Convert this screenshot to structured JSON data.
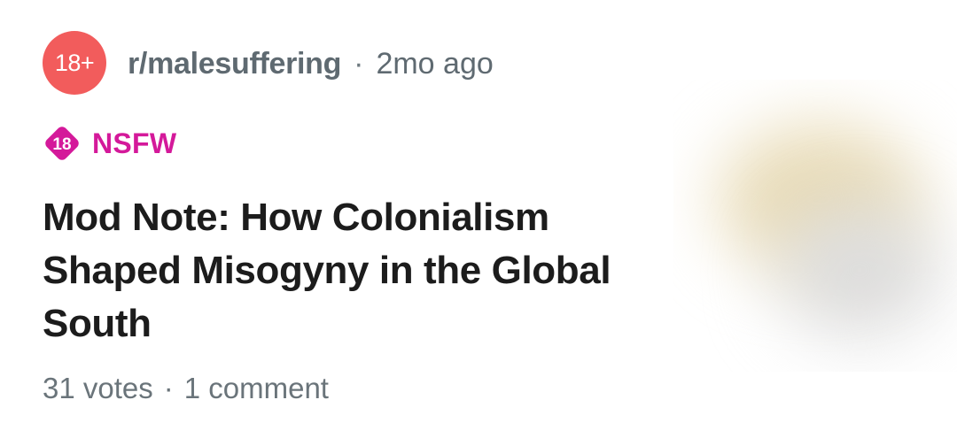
{
  "post": {
    "subreddit": {
      "avatar_text": "18+",
      "name": "r/malesuffering",
      "separator": "·",
      "age": "2mo ago"
    },
    "nsfw": {
      "icon_text": "18",
      "label": "NSFW"
    },
    "title": "Mod Note: How Colonialism Shaped Misogyny in the Global South",
    "stats": {
      "votes": "31 votes",
      "separator": "·",
      "comments": "1 comment"
    },
    "thumbnail": {
      "state": "blurred"
    }
  },
  "colors": {
    "avatar_bg": "#f25c5c",
    "nsfw": "#d4199a",
    "meta_text": "#5f6a71",
    "title_text": "#1c1c1c"
  }
}
